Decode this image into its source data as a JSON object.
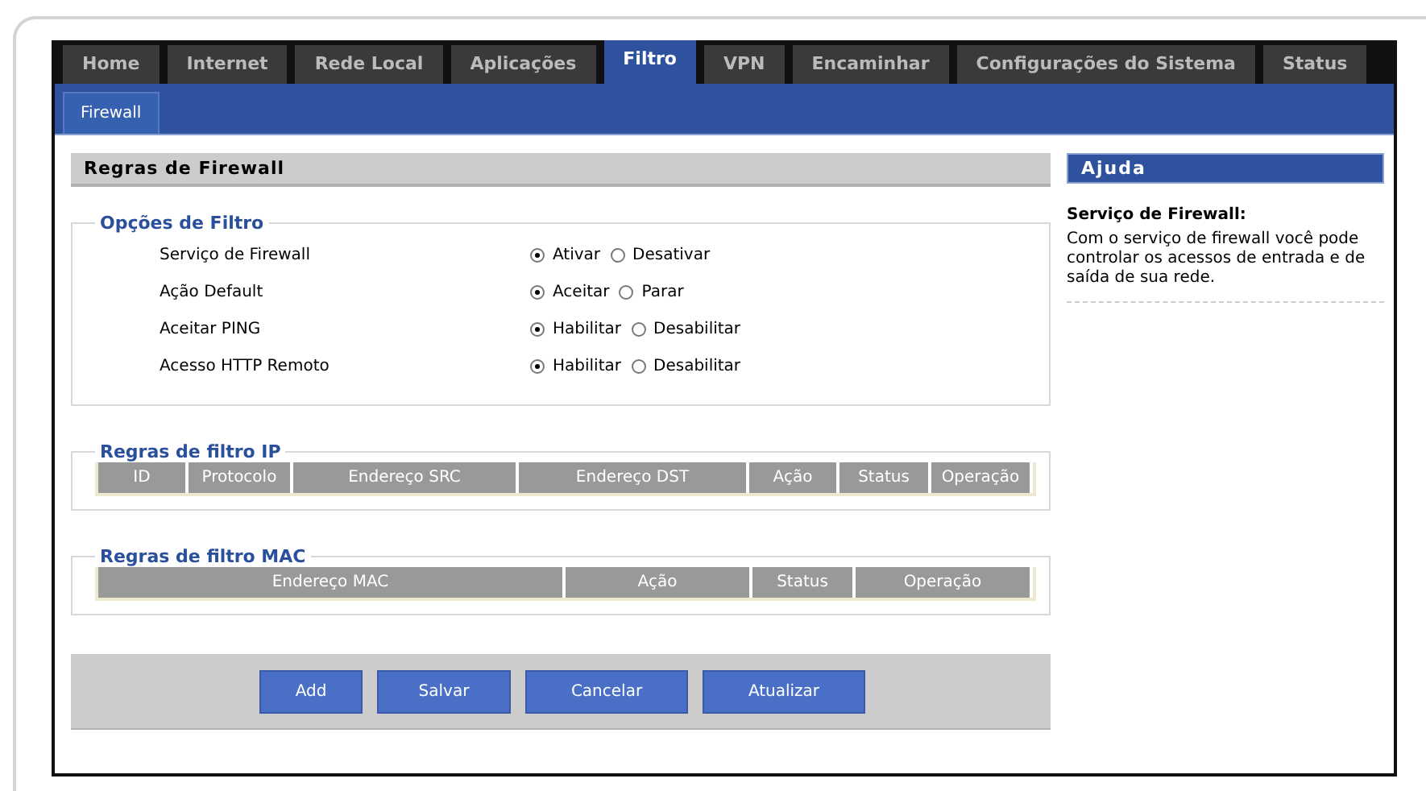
{
  "tabs": [
    {
      "label": "Home",
      "selected": false
    },
    {
      "label": "Internet",
      "selected": false
    },
    {
      "label": "Rede Local",
      "selected": false
    },
    {
      "label": "Aplicações",
      "selected": false
    },
    {
      "label": "Filtro",
      "selected": true
    },
    {
      "label": "VPN",
      "selected": false
    },
    {
      "label": "Encaminhar",
      "selected": false
    },
    {
      "label": "Configurações do Sistema",
      "selected": false
    },
    {
      "label": "Status",
      "selected": false
    }
  ],
  "subtabs": [
    {
      "label": "Firewall",
      "selected": true
    }
  ],
  "panel_title": "Regras de Firewall",
  "filter_options": {
    "legend": "Opções de Filtro",
    "rows": [
      {
        "label": "Serviço de Firewall",
        "options": [
          {
            "label": "Ativar",
            "selected": true
          },
          {
            "label": "Desativar",
            "selected": false
          }
        ]
      },
      {
        "label": "Ação Default",
        "options": [
          {
            "label": "Aceitar",
            "selected": true
          },
          {
            "label": "Parar",
            "selected": false
          }
        ]
      },
      {
        "label": "Aceitar PING",
        "options": [
          {
            "label": "Habilitar",
            "selected": true
          },
          {
            "label": "Desabilitar",
            "selected": false
          }
        ]
      },
      {
        "label": "Acesso HTTP Remoto",
        "options": [
          {
            "label": "Habilitar",
            "selected": true
          },
          {
            "label": "Desabilitar",
            "selected": false
          }
        ]
      }
    ]
  },
  "ip_rules": {
    "legend": "Regras de filtro IP",
    "columns": [
      "ID",
      "Protocolo",
      "Endereço SRC",
      "Endereço DST",
      "Ação",
      "Status",
      "Operação"
    ]
  },
  "mac_rules": {
    "legend": "Regras de filtro MAC",
    "columns": [
      "Endereço MAC",
      "Ação",
      "Status",
      "Operação"
    ]
  },
  "buttons": [
    "Add",
    "Salvar",
    "Cancelar",
    "Atualizar"
  ],
  "help": {
    "title": "Ajuda",
    "heading": "Serviço de Firewall:",
    "text": "Com o serviço de firewall você pode controlar os acessos de entrada e de saída de sua rede."
  }
}
